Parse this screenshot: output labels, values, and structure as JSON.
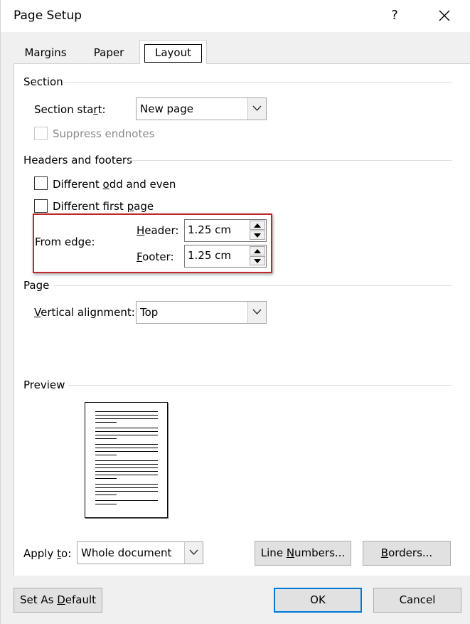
{
  "window": {
    "title": "Page Setup",
    "help_label": "?",
    "close_icon": "close-icon"
  },
  "tabs": [
    {
      "label": "Margins",
      "selected": false
    },
    {
      "label": "Paper",
      "selected": false
    },
    {
      "label": "Layout",
      "selected": true
    }
  ],
  "section": {
    "group_label": "Section",
    "start_label_pre": "Section sta",
    "start_label_u": "r",
    "start_label_post": "t:",
    "start_value": "New page",
    "suppress_endnotes_label": "Suppress endnotes",
    "suppress_endnotes_checked": false,
    "suppress_endnotes_enabled": false
  },
  "headers_footers": {
    "group_label": "Headers and footers",
    "odd_even_pre": "Different ",
    "odd_even_u": "o",
    "odd_even_post": "dd and even",
    "odd_even_checked": false,
    "first_page_pre": "Different first ",
    "first_page_u": "p",
    "first_page_post": "age",
    "first_page_checked": false,
    "from_edge_label": "From edge:",
    "header_u": "H",
    "header_post": "eader:",
    "header_value": "1.25 cm",
    "footer_u": "F",
    "footer_post": "ooter:",
    "footer_value": "1.25 cm",
    "highlight_color": "#c0262d"
  },
  "page": {
    "group_label": "Page",
    "valign_u": "V",
    "valign_post": "ertical alignment:",
    "valign_value": "Top"
  },
  "preview": {
    "group_label": "Preview"
  },
  "bottom": {
    "apply_to_pre": "Apply ",
    "apply_to_u": "t",
    "apply_to_post": "o:",
    "apply_to_value": "Whole document",
    "line_numbers_pre": "Line ",
    "line_numbers_u": "N",
    "line_numbers_post": "umbers...",
    "borders_u": "B",
    "borders_post": "orders...",
    "set_default_pre": "Set As ",
    "set_default_u": "D",
    "set_default_post": "efault",
    "ok_label": "OK",
    "cancel_label": "Cancel"
  },
  "colors": {
    "dialog_bg": "#f0f0f0",
    "panel_bg": "#ffffff",
    "accent": "#0078d7"
  }
}
